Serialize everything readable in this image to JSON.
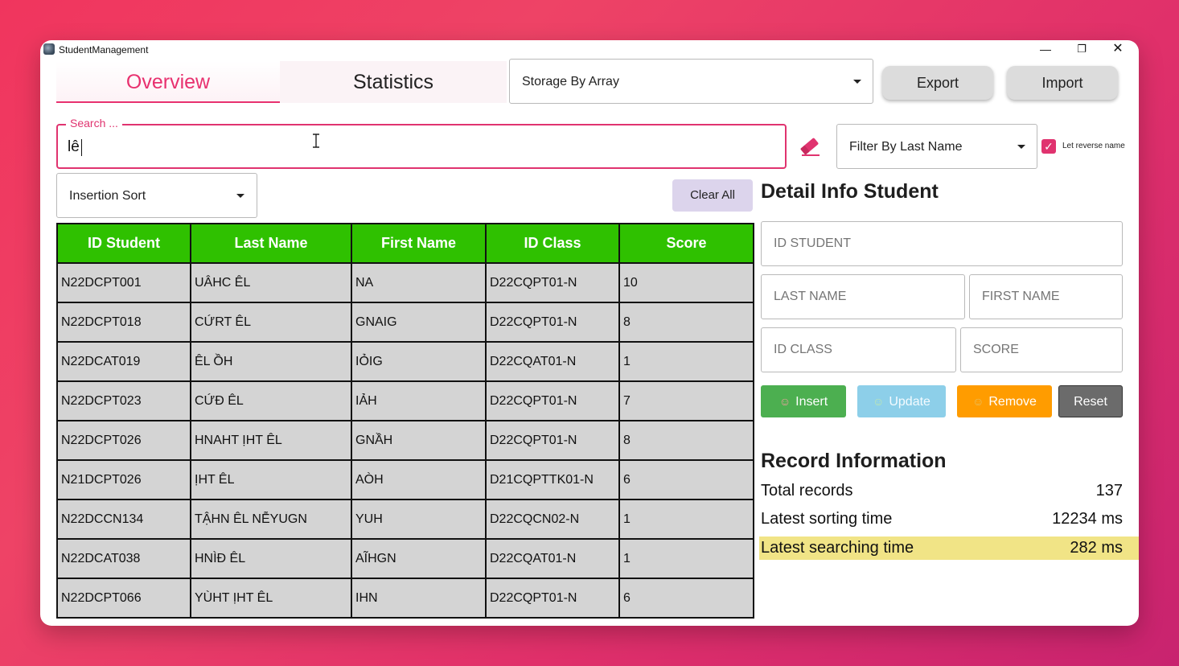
{
  "window": {
    "title": "StudentManagement"
  },
  "tabs": [
    {
      "label": "Overview",
      "active": true
    },
    {
      "label": "Statistics",
      "active": false
    }
  ],
  "storage_select": {
    "value": "Storage By Array"
  },
  "buttons": {
    "export": "Export",
    "import": "Import",
    "clear_all": "Clear All"
  },
  "search": {
    "legend": "Search ...",
    "value": "lê"
  },
  "filter_select": {
    "value": "Filter By Last Name"
  },
  "reverse_name": {
    "label": "Let reverse name",
    "checked": true
  },
  "sort_select": {
    "value": "Insertion Sort"
  },
  "table": {
    "headers": [
      "ID Student",
      "Last Name",
      "First Name",
      "ID Class",
      "Score"
    ],
    "rows": [
      [
        "N22DCPT001",
        "UÂHC ÊL",
        "NA",
        "D22CQPT01-N",
        "10"
      ],
      [
        "N22DCPT018",
        "CỨRT ÊL",
        "GNAIG",
        "D22CQPT01-N",
        "8"
      ],
      [
        "N22DCAT019",
        "ÊL ỒH",
        "IỎIG",
        "D22CQAT01-N",
        "1"
      ],
      [
        "N22DCPT023",
        "CỨĐ ÊL",
        "IẢH",
        "D22CQPT01-N",
        "7"
      ],
      [
        "N22DCPT026",
        "HNAHT ỊHT ÊL",
        "GNẦH",
        "D22CQPT01-N",
        "8"
      ],
      [
        "N21DCPT026",
        "ỊHT ÊL",
        "AÒH",
        "D21CQPTTK01-N",
        "6"
      ],
      [
        "N22DCCN134",
        "TẬHN ÊL NỄYUGN",
        "YUH",
        "D22CQCN02-N",
        "1"
      ],
      [
        "N22DCAT038",
        "HNÌĐ ÊL",
        "AĨHGN",
        "D22CQAT01-N",
        "1"
      ],
      [
        "N22DCPT066",
        "YÙHT ỊHT ÊL",
        "IHN",
        "D22CQPT01-N",
        "6"
      ]
    ]
  },
  "detail": {
    "title": "Detail Info Student",
    "placeholders": {
      "id_student": "ID STUDENT",
      "last_name": "LAST NAME",
      "first_name": "FIRST NAME",
      "id_class": "ID CLASS",
      "score": "SCORE"
    },
    "actions": {
      "insert": "Insert",
      "update": "Update",
      "remove": "Remove",
      "reset": "Reset"
    }
  },
  "record": {
    "title": "Record Information",
    "items": [
      {
        "label": "Total records",
        "value": "137"
      },
      {
        "label": "Latest sorting time",
        "value": "12234 ms"
      },
      {
        "label": "Latest searching time",
        "value": "282 ms"
      }
    ]
  },
  "colors": {
    "accent": "#e0336f",
    "header_green": "#2fc100",
    "insert": "#4caf50",
    "update": "#87ceeb",
    "remove": "#ff9800",
    "reset": "#6b6b6b",
    "highlight": "#f1e486"
  }
}
